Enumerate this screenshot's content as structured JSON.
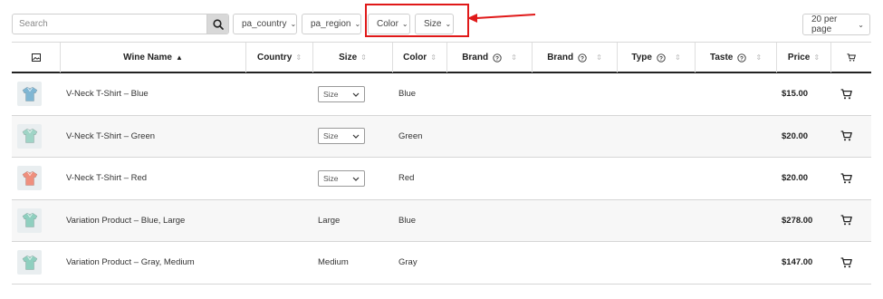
{
  "toolbar": {
    "search_placeholder": "Search",
    "filters": [
      {
        "label": "pa_country"
      },
      {
        "label": "pa_region"
      },
      {
        "label": "Color"
      },
      {
        "label": "Size"
      }
    ],
    "per_page": "20 per page"
  },
  "annotation": {
    "color": "#e01919"
  },
  "table": {
    "headers": {
      "image_icon": "image-icon",
      "wine_name": "Wine Name",
      "country": "Country",
      "size": "Size",
      "color": "Color",
      "brand_1": "Brand",
      "brand_2": "Brand",
      "type": "Type",
      "taste": "Taste",
      "price": "Price",
      "cart_icon": "cart-icon"
    },
    "rows": [
      {
        "name": "V-Neck T-Shirt – Blue",
        "size_select": "Size",
        "color": "Blue",
        "price": "$15.00",
        "shirt_color": "#7fb6d3"
      },
      {
        "name": "V-Neck T-Shirt – Green",
        "size_select": "Size",
        "color": "Green",
        "price": "$20.00",
        "shirt_color": "#9fd4c6"
      },
      {
        "name": "V-Neck T-Shirt – Red",
        "size_select": "Size",
        "color": "Red",
        "price": "$20.00",
        "shirt_color": "#ef8f7d"
      },
      {
        "name": "Variation Product – Blue, Large",
        "size": "Large",
        "color": "Blue",
        "price": "$278.00",
        "shirt_color": "#8fcfbf"
      },
      {
        "name": "Variation Product – Gray, Medium",
        "size": "Medium",
        "color": "Gray",
        "price": "$147.00",
        "shirt_color": "#8fcfbf"
      }
    ]
  }
}
